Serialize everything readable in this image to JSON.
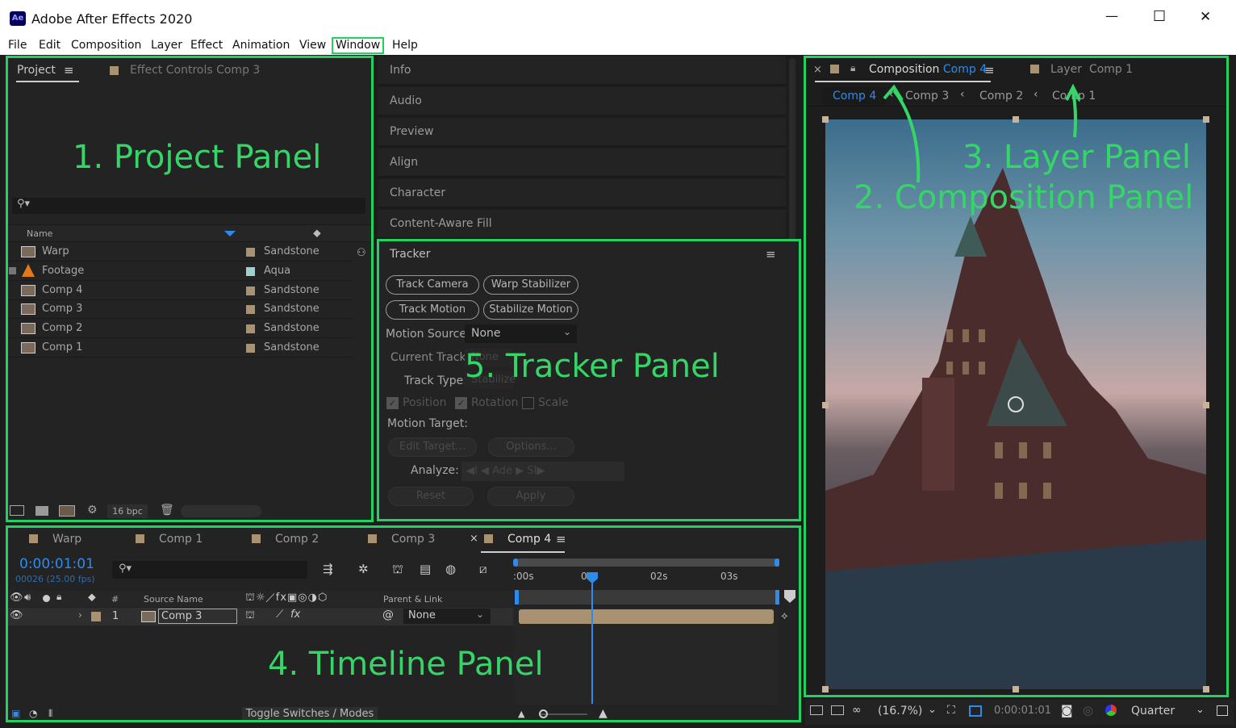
{
  "app": {
    "title": "Adobe After Effects 2020",
    "logo": "Ae"
  },
  "window_controls": {
    "minimize": "—",
    "maximize": "☐",
    "close": "✕"
  },
  "menu": [
    "File",
    "Edit",
    "Composition",
    "Layer",
    "Effect",
    "Animation",
    "View",
    "Window",
    "Help"
  ],
  "project": {
    "tab_label": "Project",
    "tab_menu": "≡",
    "effect_tab": "Effect Controls Comp 3",
    "col_name": "Name",
    "bpc": "16 bpc",
    "items": [
      {
        "name": "Warp",
        "label": "Sandstone",
        "icon": "composition-icon"
      },
      {
        "name": "Footage",
        "label": "Aqua",
        "icon": "footage-cone-icon"
      },
      {
        "name": "Comp 4",
        "label": "Sandstone",
        "icon": "composition-icon"
      },
      {
        "name": "Comp 3",
        "label": "Sandstone",
        "icon": "composition-icon"
      },
      {
        "name": "Comp 2",
        "label": "Sandstone",
        "icon": "composition-icon"
      },
      {
        "name": "Comp 1",
        "label": "Sandstone",
        "icon": "composition-icon"
      }
    ]
  },
  "side_panels": [
    "Info",
    "Audio",
    "Preview",
    "Align",
    "Character",
    "Content-Aware Fill"
  ],
  "tracker": {
    "title": "Tracker",
    "menu": "≡",
    "buttons": [
      "Track Camera",
      "Warp Stabilizer",
      "Track Motion",
      "Stabilize Motion"
    ],
    "motion_source_label": "Motion Source:",
    "motion_source_value": "None",
    "current_track_label": "Current Track:",
    "current_track_value": "None",
    "track_type_label": "Track Type:",
    "track_type_value": "Stabilize",
    "checks": [
      "Position",
      "Rotation",
      "Scale"
    ],
    "motion_target_label": "Motion Target:",
    "edit_target": "Edit Target...",
    "options": "Options...",
    "analyze_label": "Analyze:",
    "analyze_glyphs": "◀I ◀ Ade ▶ SI▶",
    "reset": "Reset",
    "apply": "Apply"
  },
  "composition": {
    "close": "×",
    "tab_label": "Composition",
    "tab_comp": "Comp 4",
    "tab_menu": "≡",
    "layer_tab_label": "Layer",
    "layer_tab_comp": "Comp 1",
    "breadcrumbs": [
      "Comp 4",
      "Comp 3",
      "Comp 2",
      "Comp 1"
    ],
    "zoom": "(16.7%)",
    "timecode": "0:00:01:01",
    "resolution": "Quarter"
  },
  "timeline": {
    "tabs": [
      "Warp",
      "Comp 1",
      "Comp 2",
      "Comp 3",
      "Comp 4"
    ],
    "close": "×",
    "menu": "≡",
    "timecode": "0:00:01:01",
    "frames": "00026 (25.00 fps)",
    "ruler": [
      ":00s",
      "01s",
      "02s",
      "03s"
    ],
    "col_num": "#",
    "col_source": "Source Name",
    "col_parent": "Parent & Link",
    "layer": {
      "index": "1",
      "name": "Comp 3",
      "parent": "None"
    },
    "toggle": "Toggle Switches / Modes"
  },
  "annotations": [
    "1. Project Panel",
    "2. Composition Panel",
    "3. Layer Panel",
    "4. Timeline Panel",
    "5. Tracker Panel"
  ],
  "colors": {
    "sandstone": "#a89272",
    "aqua": "#9fcfce",
    "accent_blue": "#2d8ceb",
    "annotation_green": "#22d160"
  }
}
